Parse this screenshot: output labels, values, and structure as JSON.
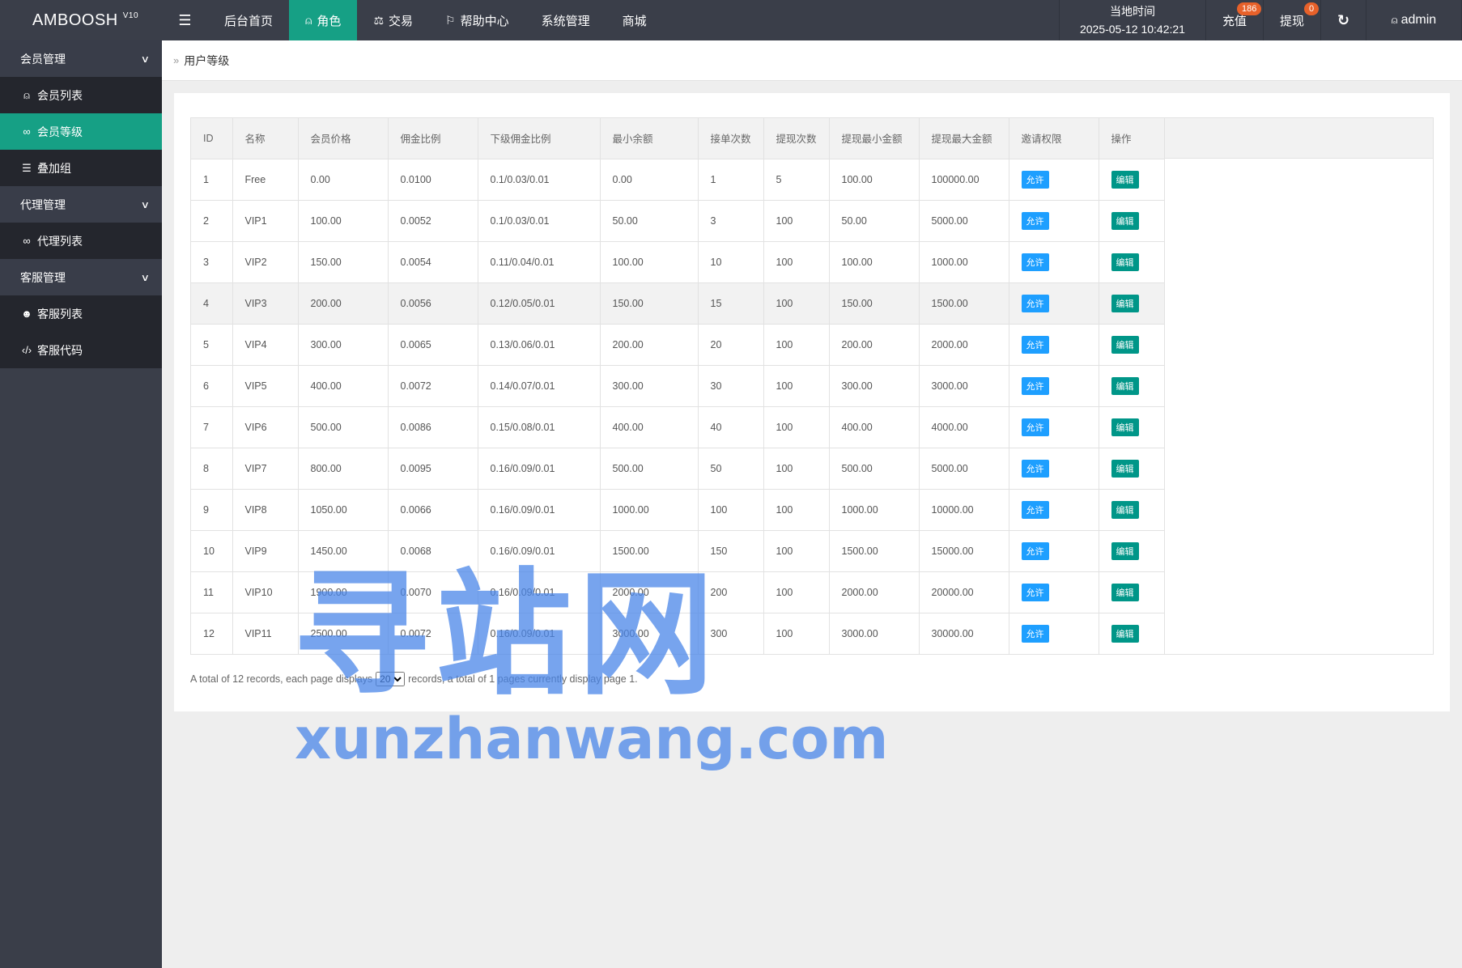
{
  "app": {
    "logo": "AMBOOSH",
    "version": "V10"
  },
  "topnav": {
    "menu_icon": "menu-icon",
    "items": [
      {
        "label": "后台首页",
        "icon": ""
      },
      {
        "label": "角色",
        "icon": "user-icon",
        "active": true
      },
      {
        "label": "交易",
        "icon": "scale-icon"
      },
      {
        "label": "帮助中心",
        "icon": "flag-icon"
      },
      {
        "label": "系统管理",
        "icon": ""
      },
      {
        "label": "商城",
        "icon": ""
      }
    ]
  },
  "header": {
    "time_label": "当地时间",
    "time_value": "2025-05-12 10:42:21",
    "recharge_label": "充值",
    "recharge_badge": "186",
    "withdraw_label": "提现",
    "withdraw_badge": "0",
    "user": "admin"
  },
  "sidebar": {
    "groups": [
      {
        "label": "会员管理",
        "items": [
          {
            "label": "会员列表",
            "icon": "user-icon"
          },
          {
            "label": "会员等级",
            "icon": "link-icon",
            "active": true
          },
          {
            "label": "叠加组",
            "icon": "list-icon"
          }
        ]
      },
      {
        "label": "代理管理",
        "items": [
          {
            "label": "代理列表",
            "icon": "link-icon"
          }
        ]
      },
      {
        "label": "客服管理",
        "items": [
          {
            "label": "客服列表",
            "icon": "users-icon"
          },
          {
            "label": "客服代码",
            "icon": "code-icon"
          }
        ]
      }
    ]
  },
  "breadcrumb": {
    "current": "用户等级"
  },
  "table": {
    "columns": [
      "ID",
      "名称",
      "会员价格",
      "佣金比例",
      "下级佣金比例",
      "最小余额",
      "接单次数",
      "提现次数",
      "提现最小金额",
      "提现最大金额",
      "邀请权限",
      "操作"
    ],
    "allow_label": "允许",
    "edit_label": "编辑",
    "rows": [
      [
        "1",
        "Free",
        "0.00",
        "0.0100",
        "0.1/0.03/0.01",
        "0.00",
        "1",
        "5",
        "100.00",
        "100000.00"
      ],
      [
        "2",
        "VIP1",
        "100.00",
        "0.0052",
        "0.1/0.03/0.01",
        "50.00",
        "3",
        "100",
        "50.00",
        "5000.00"
      ],
      [
        "3",
        "VIP2",
        "150.00",
        "0.0054",
        "0.11/0.04/0.01",
        "100.00",
        "10",
        "100",
        "100.00",
        "1000.00"
      ],
      [
        "4",
        "VIP3",
        "200.00",
        "0.0056",
        "0.12/0.05/0.01",
        "150.00",
        "15",
        "100",
        "150.00",
        "1500.00"
      ],
      [
        "5",
        "VIP4",
        "300.00",
        "0.0065",
        "0.13/0.06/0.01",
        "200.00",
        "20",
        "100",
        "200.00",
        "2000.00"
      ],
      [
        "6",
        "VIP5",
        "400.00",
        "0.0072",
        "0.14/0.07/0.01",
        "300.00",
        "30",
        "100",
        "300.00",
        "3000.00"
      ],
      [
        "7",
        "VIP6",
        "500.00",
        "0.0086",
        "0.15/0.08/0.01",
        "400.00",
        "40",
        "100",
        "400.00",
        "4000.00"
      ],
      [
        "8",
        "VIP7",
        "800.00",
        "0.0095",
        "0.16/0.09/0.01",
        "500.00",
        "50",
        "100",
        "500.00",
        "5000.00"
      ],
      [
        "9",
        "VIP8",
        "1050.00",
        "0.0066",
        "0.16/0.09/0.01",
        "1000.00",
        "100",
        "100",
        "1000.00",
        "10000.00"
      ],
      [
        "10",
        "VIP9",
        "1450.00",
        "0.0068",
        "0.16/0.09/0.01",
        "1500.00",
        "150",
        "100",
        "1500.00",
        "15000.00"
      ],
      [
        "11",
        "VIP10",
        "1900.00",
        "0.0070",
        "0.16/0.09/0.01",
        "2000.00",
        "200",
        "100",
        "2000.00",
        "20000.00"
      ],
      [
        "12",
        "VIP11",
        "2500.00",
        "0.0072",
        "0.16/0.09/0.01",
        "3000.00",
        "300",
        "100",
        "3000.00",
        "30000.00"
      ]
    ]
  },
  "pager": {
    "text_before": "A total of 12 records, each page displays",
    "page_size": "20",
    "text_after": "records, a total of 1 pages currently display page 1."
  },
  "watermark": {
    "line1": "寻站网",
    "line2": "xunzhanwang.com"
  },
  "colors": {
    "accent": "#16a085",
    "topbar": "#3a3e49",
    "allow": "#1e9fff",
    "edit": "#009688",
    "badge": "#e7612a"
  }
}
